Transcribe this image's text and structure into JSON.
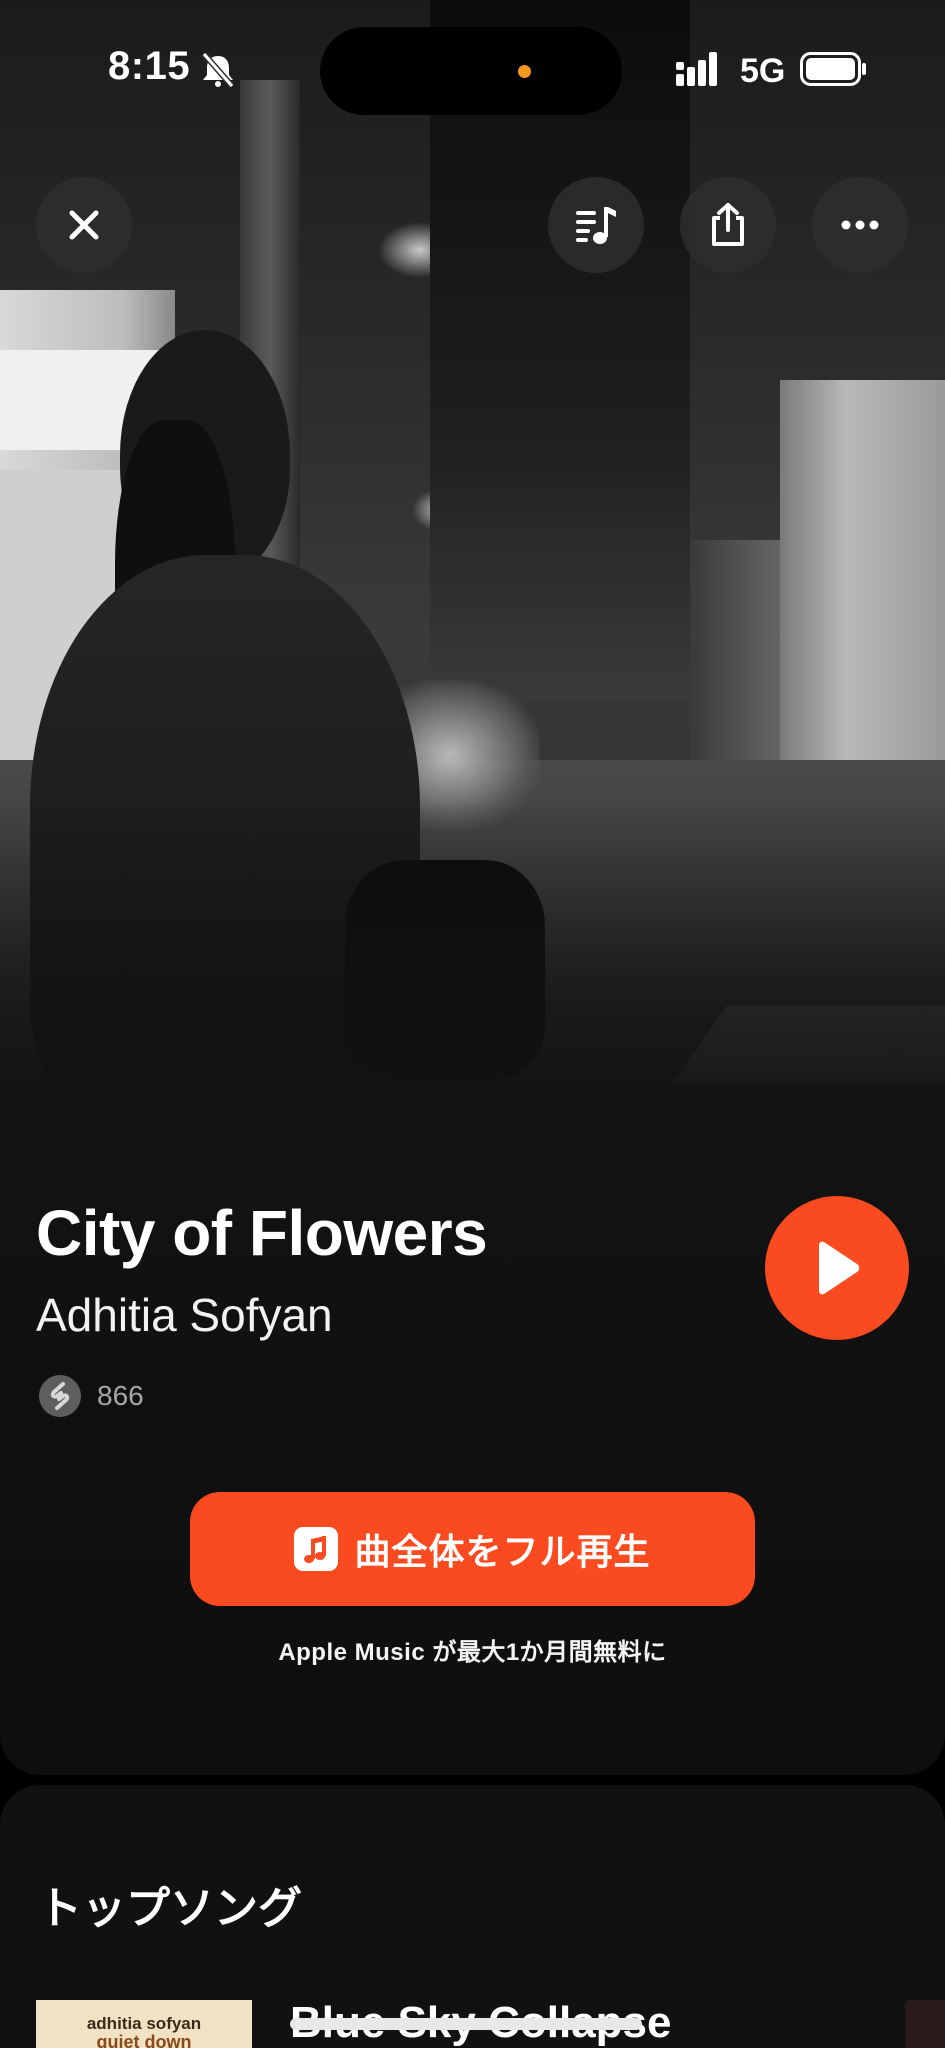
{
  "status_bar": {
    "time": "8:15",
    "network": "5G",
    "icons": [
      "bell-slash-icon",
      "signal-icon",
      "battery-icon"
    ]
  },
  "top_controls": {
    "icons": [
      "close-icon",
      "queue-music-icon",
      "share-icon",
      "more-icon"
    ]
  },
  "song": {
    "title": "City of Flowers",
    "artist": "Adhitia Sofyan",
    "shazam_count": "866"
  },
  "actions": {
    "full_play_label": "曲全体をフル再生",
    "promo": "Apple Music が最大1か月間無料に"
  },
  "top_songs": {
    "heading": "トップソング",
    "items": [
      {
        "title": "Blue Sky Collapse",
        "thumb_line1": "adhitia sofyan",
        "thumb_line2": "quiet down"
      }
    ]
  },
  "colors": {
    "accent": "#fa4a1f",
    "background": "#121212",
    "island_dot": "#f39a1e"
  }
}
